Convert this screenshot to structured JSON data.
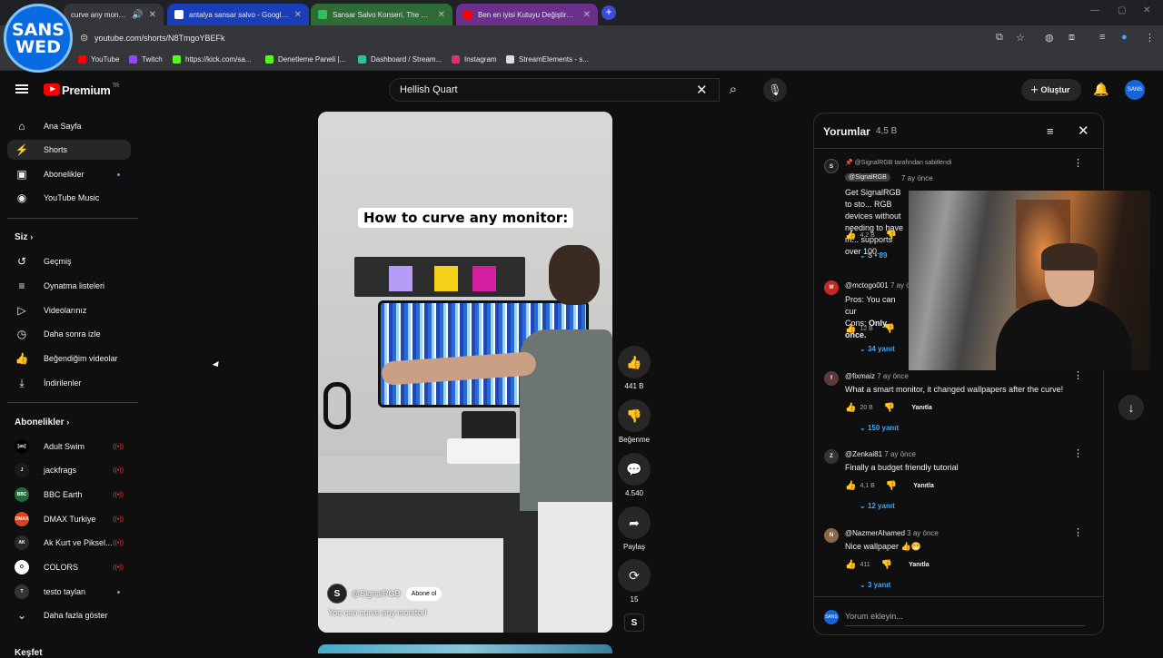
{
  "browser": {
    "tabs": [
      {
        "label": "curve any monitor",
        "active": true
      },
      {
        "label": "antalya sansar salvo - Google'd"
      },
      {
        "label": "Sansar Salvo Konseri, The Bar"
      },
      {
        "label": "Ben en iyisi Kutuyu Değiştireyim"
      }
    ],
    "url": "youtube.com/shorts/N8TmgoYBEFk",
    "bookmarks": [
      "YouTube",
      "Twitch",
      "https://kick.com/sa...",
      "Denetleme Paneli |...",
      "Dashboard / Stream...",
      "Instagram",
      "StreamElements - s..."
    ]
  },
  "overlay_logo": {
    "line1": "SANS",
    "line2": "WED"
  },
  "header": {
    "brand": "Premium",
    "region": "TR",
    "search_value": "Hellish Quart",
    "create_label": "Oluştur",
    "avatar_text": "SANS"
  },
  "sidebar": {
    "main": [
      {
        "label": "Ana Sayfa",
        "icon": "home-icon"
      },
      {
        "label": "Shorts",
        "icon": "shorts-icon"
      },
      {
        "label": "Abonelikler",
        "icon": "subscriptions-icon"
      },
      {
        "label": "YouTube Music",
        "icon": "music-icon"
      }
    ],
    "you_heading": "Siz",
    "you": [
      {
        "label": "Geçmiş",
        "icon": "history-icon"
      },
      {
        "label": "Oynatma listeleri",
        "icon": "playlist-icon"
      },
      {
        "label": "Videolarınız",
        "icon": "your-videos-icon"
      },
      {
        "label": "Daha sonra izle",
        "icon": "watch-later-icon"
      },
      {
        "label": "Beğendiğim videolar",
        "icon": "liked-icon"
      },
      {
        "label": "İndirilenler",
        "icon": "download-icon"
      }
    ],
    "subs_heading": "Abonelikler",
    "subs": [
      {
        "label": "Adult Swim",
        "avatar": "[as]",
        "color": "#000000"
      },
      {
        "label": "jackfrags",
        "avatar": "J",
        "color": "#1a1a1a"
      },
      {
        "label": "BBC Earth",
        "avatar": "BBC",
        "color": "#1f6b3a"
      },
      {
        "label": "DMAX Turkiye",
        "avatar": "DMAX",
        "color": "#d8431f"
      },
      {
        "label": "Ak Kurt ve Piksel...",
        "avatar": "AK",
        "color": "#2a2a2a"
      },
      {
        "label": "COLORS",
        "avatar": "O",
        "color": "#111111"
      },
      {
        "label": "testo taylan",
        "avatar": "T",
        "color": "#333333"
      }
    ],
    "more_label": "Daha fazla göster",
    "explore_heading": "Keşfet"
  },
  "video": {
    "caption": "How to curve any monitor:",
    "channel": "@SignalRGB",
    "subscribe_label": "Abone ol",
    "title": "You can curve any monitor!"
  },
  "actions": {
    "likes": "441 B",
    "dislike_label": "Beğenme",
    "comments": "4.540",
    "share_label": "Paylaş",
    "remix": "15"
  },
  "comments_panel": {
    "title": "Yorumlar",
    "count": "4,5 B",
    "items": [
      {
        "pinned_note": "@SignalRGB tarafından sabitlendi",
        "user": "@SignalRGB",
        "time": "7 ay önce",
        "text": "Get SignalRGB to sto... RGB devices without needing to have m... supports over 100...",
        "likes": "4,2 B",
        "replies": "89"
      },
      {
        "user": "@mctogo001",
        "time": "7 ay önce",
        "text_line1": "Pros: You can cur",
        "text_line2_prefix": "Cons:",
        "text_line2_bold": "Only once.",
        "likes": "12 B",
        "replies": "34 yanıt"
      },
      {
        "user": "@fixmaiz",
        "time": "7 ay önce",
        "text": "What a smart monitor, it changed wallpapers after the curve!",
        "likes": "20 B",
        "reply_label": "Yanıtla",
        "replies": "150 yanıt"
      },
      {
        "user": "@Zenkai81",
        "time": "7 ay önce",
        "text": "Finally a budget friendly tutorial",
        "likes": "4,1 B",
        "reply_label": "Yanıtla",
        "replies": "12 yanıt"
      },
      {
        "user": "@NazmerAhamed",
        "time": "3 ay önce",
        "text": "Nice wallpaper 👍😁",
        "likes": "411",
        "reply_label": "Yanıtla",
        "replies": "3 yanıt"
      }
    ],
    "add_placeholder": "Yorum ekleyin..."
  },
  "colors": {
    "accent": "#3ea6ff",
    "brand_red": "#ff0000",
    "background": "#0f0f0f"
  }
}
